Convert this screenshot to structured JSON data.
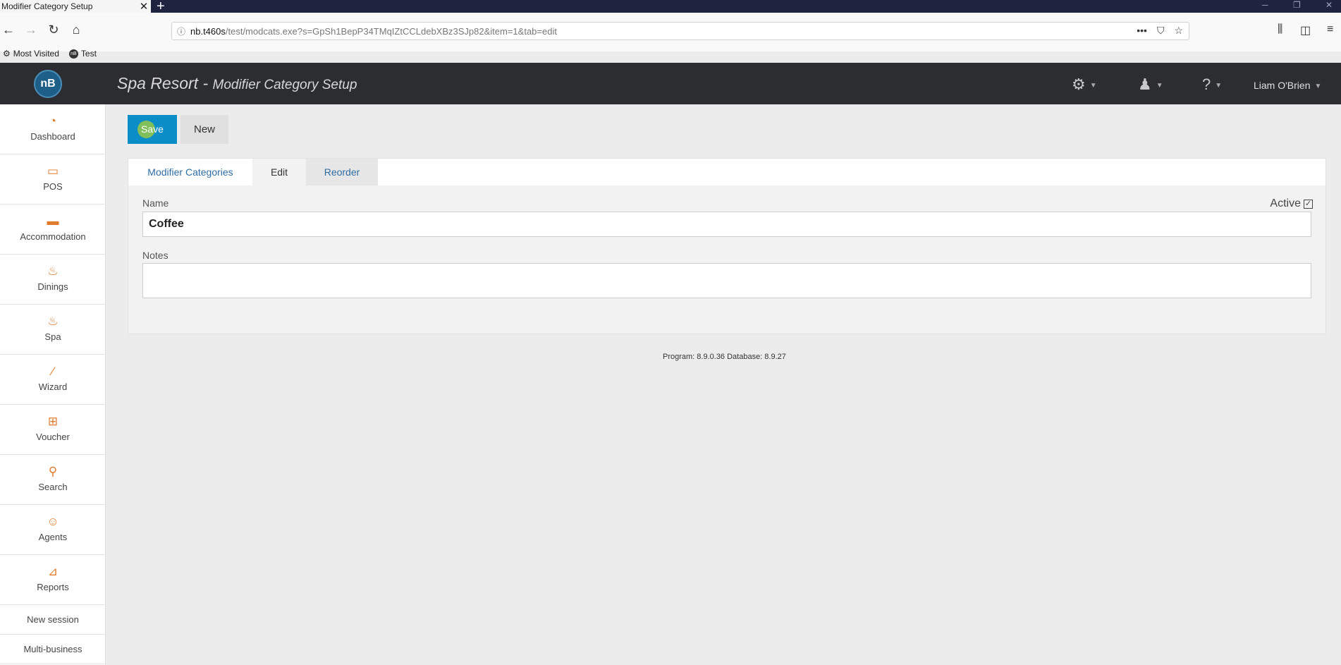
{
  "browser": {
    "tab_title": "Modifier Category Setup",
    "url_host": "nb.t460s",
    "url_path": "/test/modcats.exe?s=GpSh1BepP34TMqIZtCCLdebXBz3SJp82&item=1&tab=edit",
    "bookmarks": [
      "Most Visited",
      "Test"
    ]
  },
  "header": {
    "logo_text": "nB",
    "title": "Spa Resort -",
    "subtitle": "Modifier Category Setup",
    "user_name": "Liam O'Brien"
  },
  "sidebar": {
    "items": [
      {
        "label": "Dashboard",
        "icon": "gauge-icon",
        "glyph": "◔"
      },
      {
        "label": "POS",
        "icon": "monitor-icon",
        "glyph": "▭"
      },
      {
        "label": "Accommodation",
        "icon": "bed-icon",
        "glyph": "▬"
      },
      {
        "label": "Dinings",
        "icon": "dining-icon",
        "glyph": "♨"
      },
      {
        "label": "Spa",
        "icon": "spa-icon",
        "glyph": "♨"
      },
      {
        "label": "Wizard",
        "icon": "wand-icon",
        "glyph": "⁄"
      },
      {
        "label": "Voucher",
        "icon": "gift-icon",
        "glyph": "⊞"
      },
      {
        "label": "Search",
        "icon": "search-icon",
        "glyph": "⚲"
      },
      {
        "label": "Agents",
        "icon": "agent-icon",
        "glyph": "☺"
      },
      {
        "label": "Reports",
        "icon": "chart-icon",
        "glyph": "⊿"
      }
    ],
    "new_session": "New session",
    "multi_business": "Multi-business"
  },
  "toolbar": {
    "save_label": "Save",
    "new_label": "New"
  },
  "tabs": {
    "modifier_categories": "Modifier Categories",
    "edit": "Edit",
    "reorder": "Reorder"
  },
  "form": {
    "name_label": "Name",
    "name_value": "Coffee",
    "active_label": "Active",
    "active_checked": true,
    "notes_label": "Notes",
    "notes_value": ""
  },
  "footer": {
    "version": "Program: 8.9.0.36 Database: 8.9.27"
  },
  "colors": {
    "header_bg": "#2b2d31",
    "accent": "#0b8ec8",
    "icon_orange": "#e07b2e"
  }
}
